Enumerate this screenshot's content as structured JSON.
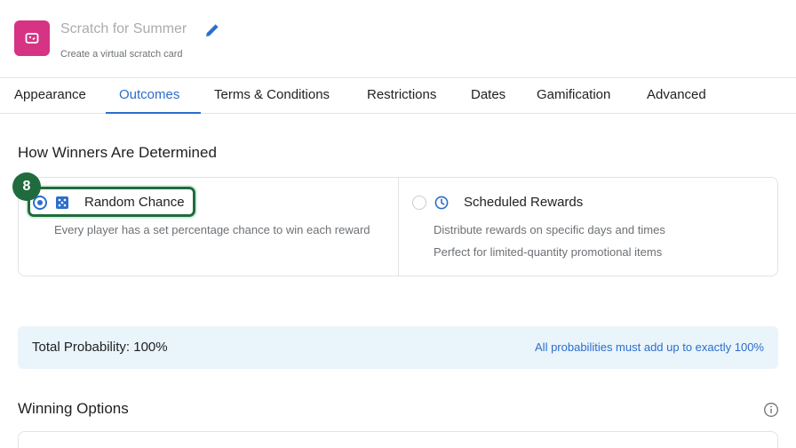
{
  "header": {
    "title": "Scratch for Summer",
    "subtitle": "Create a virtual scratch card",
    "accent_color": "#d63384",
    "app_icon": "ticket-icon",
    "edit_icon": "pencil-icon"
  },
  "tabs": [
    {
      "label": "Appearance",
      "active": false
    },
    {
      "label": "Outcomes",
      "active": true
    },
    {
      "label": "Terms & Conditions",
      "active": false
    },
    {
      "label": "Restrictions",
      "active": false
    },
    {
      "label": "Dates",
      "active": false
    },
    {
      "label": "Gamification",
      "active": false
    },
    {
      "label": "Advanced",
      "active": false
    }
  ],
  "winners_section": {
    "title": "How Winners Are Determined",
    "options": [
      {
        "label": "Random Chance",
        "icon": "dice-icon",
        "selected": true,
        "description": "Every player has a set percentage chance to win each reward"
      },
      {
        "label": "Scheduled Rewards",
        "icon": "clock-icon",
        "selected": false,
        "description_lines": [
          "Distribute rewards on specific days and times",
          "Perfect for limited-quantity promotional items"
        ]
      }
    ],
    "step_badge": "8"
  },
  "probability": {
    "total": "Total Probability: 100%",
    "note": "All probabilities must add up to exactly 100%"
  },
  "winning_options": {
    "title": "Winning Options",
    "info_icon": "info-icon"
  },
  "colors": {
    "link_blue": "#2c6ecb",
    "highlight_green": "#1f6b3d",
    "banner_bg": "#eaf4fb"
  }
}
